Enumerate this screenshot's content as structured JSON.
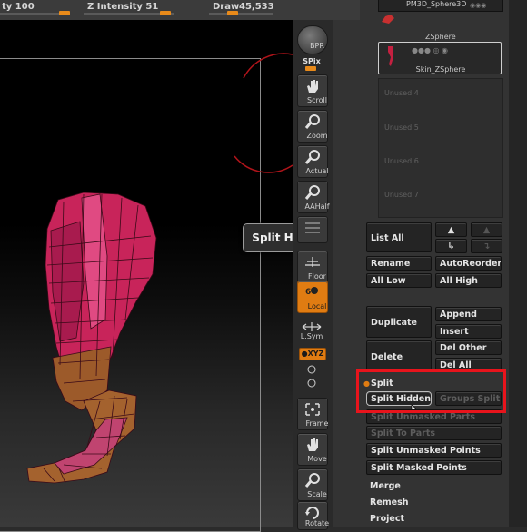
{
  "top_bar": {
    "rgb_intensity_label": "ty 100",
    "z_intensity_label": "Z Intensity 51",
    "draw_label": "Draw",
    "draw_value": "45,533",
    "rgb_intensity_level": 1.0,
    "z_intensity_level": 0.51
  },
  "shelf": {
    "bpr": "BPR",
    "spix": "SPix",
    "scroll": "Scroll",
    "zoom": "Zoom",
    "actual": "Actual",
    "aahalf": "AAHalf",
    "floor": "Floor",
    "local": "Local",
    "lsym": "L.Sym",
    "xyz": "●XYZ",
    "frame": "Frame",
    "move": "Move",
    "scale": "Scale",
    "rotate": "Rotate"
  },
  "subtool": {
    "item1_name": "PM3D_Sphere3D",
    "item2_name": "ZSphere",
    "item3_name": "Skin_ZSphere",
    "unused_4": "Unused 4",
    "unused_5": "Unused 5",
    "unused_6": "Unused 6",
    "unused_7": "Unused 7"
  },
  "buttons": {
    "list_all": "List  All",
    "rename": "Rename",
    "autoreorder": "AutoReorder",
    "all_low": "All  Low",
    "all_high": "All  High",
    "duplicate": "Duplicate",
    "append": "Append",
    "insert": "Insert",
    "delete": "Delete",
    "del_other": "Del  Other",
    "del_all": "Del  All",
    "split_header": "Split",
    "split_hidden": "Split  Hidden",
    "groups_split": "Groups  Split",
    "split_unmasked_parts": "Split  Unmasked  Parts",
    "split_to_parts": "Split  To  Parts",
    "split_unmasked_points": "Split  Unmasked  Points",
    "split_masked_points": "Split  Masked  Points",
    "merge": "Merge",
    "remesh": "Remesh",
    "project": "Project"
  },
  "tooltip": "Split  Hidden",
  "colors": {
    "accent": "#e07c12",
    "highlight": "#e8141c",
    "mesh_top": "#c8245a",
    "mesh_bottom": "#8e5a28"
  }
}
